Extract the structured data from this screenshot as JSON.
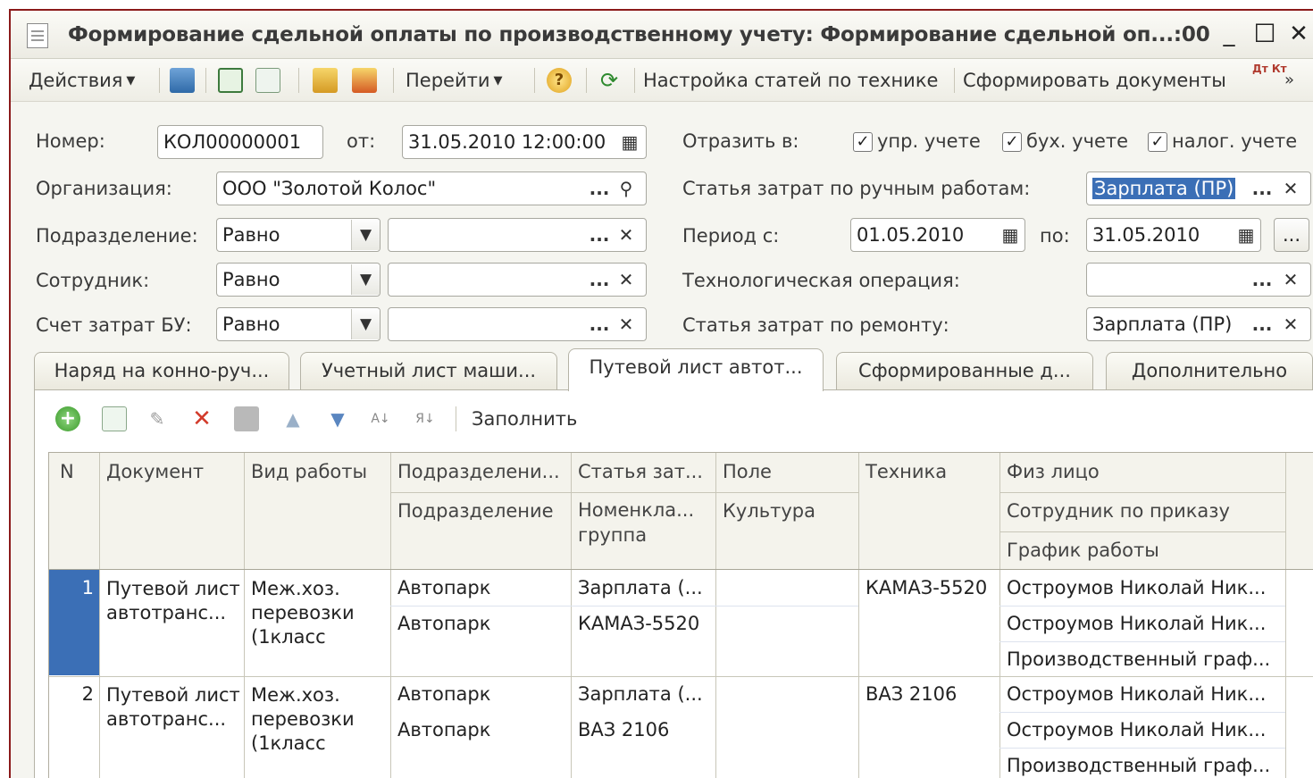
{
  "window": {
    "title": "Формирование сдельной оплаты по производственному учету: Формирование сдельной оп...:00",
    "minimize": "_",
    "maximize": "☐",
    "close": "✕"
  },
  "toolbar": {
    "actions": "Действия",
    "goto": "Перейти",
    "help": "?",
    "settings": "Настройка статей по технике",
    "generate": "Сформировать документы",
    "dt_kt": "Дт Кт",
    "more": "»"
  },
  "form": {
    "number_label": "Номер:",
    "number_value": "КОЛ00000001",
    "from_label": "от:",
    "from_value": "31.05.2010 12:00:00",
    "reflect_label": "Отразить в:",
    "reflect_mgmt": "упр. учете",
    "reflect_acc": "бух. учете",
    "reflect_tax": "налог. учете",
    "org_label": "Организация:",
    "org_value": "ООО \"Золотой Колос\"",
    "manual_cost_label": "Статья затрат по ручным работам:",
    "manual_cost_value": "Зарплата (ПР)",
    "dept_label": "Подразделение:",
    "dept_cond": "Равно",
    "dept_value": "",
    "period_label": "Период с:",
    "period_from": "01.05.2010",
    "period_to_label": "по:",
    "period_to": "31.05.2010",
    "employee_label": "Сотрудник:",
    "employee_cond": "Равно",
    "employee_value": "",
    "tech_op_label": "Технологическая операция:",
    "tech_op_value": "",
    "account_label": "Счет затрат БУ:",
    "account_cond": "Равно",
    "account_value": "",
    "repair_label": "Статья затрат по ремонту:",
    "repair_value": "Зарплата (ПР)",
    "ellipsis": "...",
    "clear": "✕",
    "search": "⚲",
    "dropdown": "▼",
    "more_btn": "..."
  },
  "tabs": [
    {
      "label": "Наряд на конно-руч..."
    },
    {
      "label": "Учетный лист маши..."
    },
    {
      "label": "Путевой лист автот..."
    },
    {
      "label": "Сформированные д..."
    },
    {
      "label": "Дополнительно"
    }
  ],
  "table_toolbar": {
    "fill": "Заполнить"
  },
  "table": {
    "headers": {
      "n": "N",
      "document": "Документ",
      "work_type": "Вид работы",
      "dept1": "Подразделени...",
      "dept2": "Подразделение",
      "cost1": "Статья зат...",
      "cost2": "Номенкла... группа",
      "field1": "Поле",
      "field2": "Культура",
      "tech": "Техника",
      "person1": "Физ лицо",
      "person2": "Сотрудник по приказу",
      "person3": "График работы"
    },
    "rows": [
      {
        "n": "1",
        "document": "Путевой лист автотранс...",
        "work_type": "Меж.хоз. перевозки (1класс",
        "dept1": "Автопарк",
        "dept2": "Автопарк",
        "cost1": "Зарплата (...",
        "cost2": "КАМАЗ-5520",
        "field1": "",
        "field2": "",
        "tech": "КАМАЗ-5520",
        "person1": "Остроумов Николай Ник...",
        "person2": "Остроумов Николай Ник...",
        "person3": "Производственный граф..."
      },
      {
        "n": "2",
        "document": "Путевой лист автотранс...",
        "work_type": "Меж.хоз. перевозки (1класс",
        "dept1": "Автопарк",
        "dept2": "Автопарк",
        "cost1": "Зарплата (...",
        "cost2": "ВАЗ 2106",
        "field1": "",
        "field2": "",
        "tech": "ВАЗ 2106",
        "person1": "Остроумов Николай Ник...",
        "person2": "Остроумов Николай Ник...",
        "person3": "Производственный граф..."
      }
    ]
  },
  "colors": {
    "accent": "#3b6fb6",
    "border": "#8b1a1a"
  }
}
